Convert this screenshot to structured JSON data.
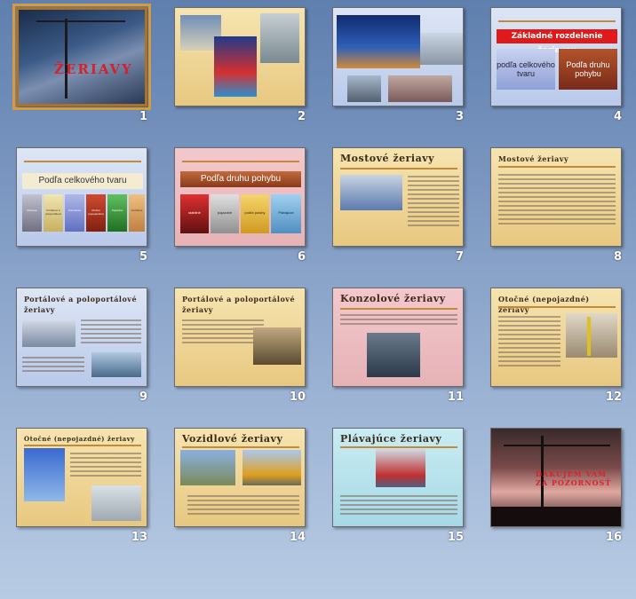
{
  "slides": [
    {
      "n": "1",
      "title": "Žeriavy"
    },
    {
      "n": "2"
    },
    {
      "n": "3"
    },
    {
      "n": "4",
      "title": "Základné rozdelenie žeriavov",
      "box1": "podľa celkového tvaru",
      "box2": "Podľa druhu pohybu"
    },
    {
      "n": "5",
      "title": "Podľa celkového tvaru",
      "items": [
        "Mostové",
        "Portálové a poloportálové",
        "Konzolové",
        "Otočné (nepojazdné)",
        "Pojazdné",
        "Vozidlové"
      ]
    },
    {
      "n": "6",
      "title": "Podľa druhu pohybu",
      "items": [
        "stabilné",
        "pojazdné",
        "podľa polohy",
        "Plávajúce"
      ]
    },
    {
      "n": "7",
      "title": "Mostové žeriavy"
    },
    {
      "n": "8",
      "title": "Mostové žeriavy"
    },
    {
      "n": "9",
      "title": "Portálové a poloportálové žeriavy"
    },
    {
      "n": "10",
      "title": "Portálové a poloportálové žeriavy"
    },
    {
      "n": "11",
      "title": "Konzolové žeriavy"
    },
    {
      "n": "12",
      "title": "Otočné (nepojazdné) žeriavy"
    },
    {
      "n": "13",
      "title": "Otočné (nepojazdné) žeriavy"
    },
    {
      "n": "14",
      "title": "Vozidlové žeriavy"
    },
    {
      "n": "15",
      "title": "Plávajúce žeriavy"
    },
    {
      "n": "16",
      "title": "Ďakujem vám za pozornosť"
    }
  ],
  "colors": {
    "selection": "#d79a3c",
    "accent": "#c48a3a"
  }
}
